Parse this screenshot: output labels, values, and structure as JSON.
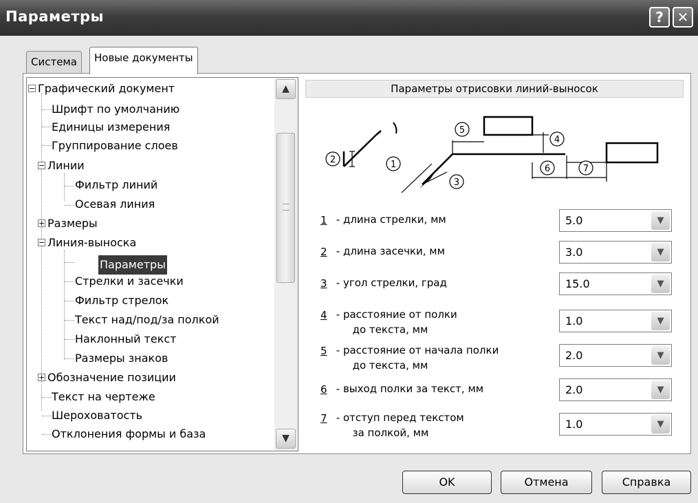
{
  "window": {
    "title": "Параметры",
    "help_button": "?",
    "close_button": "✕"
  },
  "tabs": [
    {
      "label": "Система",
      "active": false
    },
    {
      "label": "Новые документы",
      "active": true
    }
  ],
  "tree": {
    "items": [
      {
        "label": "Графический документ",
        "expander": "−"
      },
      {
        "label": "Шрифт по умолчанию"
      },
      {
        "label": "Единицы измерения"
      },
      {
        "label": "Группирование слоев"
      },
      {
        "label": "Линии",
        "expander": "−"
      },
      {
        "label": "Фильтр линий"
      },
      {
        "label": "Осевая линия"
      },
      {
        "label": "Размеры",
        "expander": "+"
      },
      {
        "label": "Линия-выноска",
        "expander": "−"
      },
      {
        "label": "Параметры",
        "selected": true
      },
      {
        "label": "Стрелки и засечки"
      },
      {
        "label": "Фильтр стрелок"
      },
      {
        "label": "Текст над/под/за полкой"
      },
      {
        "label": "Наклонный текст"
      },
      {
        "label": "Размеры знаков"
      },
      {
        "label": "Обозначение позиции",
        "expander": "+"
      },
      {
        "label": "Текст на чертеже"
      },
      {
        "label": "Шероховатость"
      },
      {
        "label": "Отклонения формы и база"
      }
    ],
    "scroll_up_icon": "▲",
    "scroll_down_icon": "▼"
  },
  "right_panel": {
    "title": "Параметры отрисовки линий-выносок",
    "diagram_labels": [
      "1",
      "2",
      "3",
      "4",
      "5",
      "6",
      "7"
    ],
    "params": [
      {
        "num": "1",
        "label": " - длина стрелки, мм",
        "value": "5.0"
      },
      {
        "num": "2",
        "label": " - длина засечки, мм",
        "value": "3.0"
      },
      {
        "num": "3",
        "label": " - угол стрелки, град",
        "value": "15.0"
      },
      {
        "num": "4",
        "label": " - расстояние от полки\n      до текста, мм",
        "value": "1.0"
      },
      {
        "num": "5",
        "label": " - расстояние от начала полки\n      до текста, мм",
        "value": "2.0"
      },
      {
        "num": "6",
        "label": " - выход полки за текст, мм",
        "value": "2.0"
      },
      {
        "num": "7",
        "label": " - отступ перед текстом\n      за полкой, мм",
        "value": "1.0"
      }
    ]
  },
  "buttons": {
    "ok": "OK",
    "cancel": "Отмена",
    "help": "Справка"
  }
}
